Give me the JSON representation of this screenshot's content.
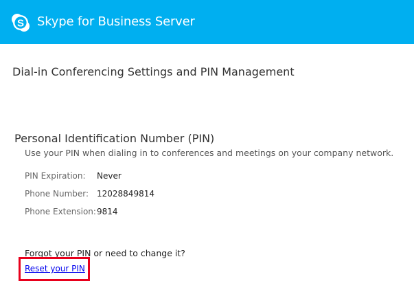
{
  "header": {
    "logo_icon": "skype-logo-icon",
    "title": "Skype for Business Server",
    "background_color": "#00AFF0"
  },
  "page": {
    "title": "Dial-in Conferencing Settings and PIN Management"
  },
  "pin_section": {
    "title": "Personal Identification Number (PIN)",
    "description": "Use your PIN when dialing in to conferences and meetings on your company network.",
    "rows": [
      {
        "label": "PIN Expiration:",
        "value": "Never"
      },
      {
        "label": "Phone Number:",
        "value": "12028849814"
      },
      {
        "label": "Phone Extension:",
        "value": "9814"
      }
    ]
  },
  "reset": {
    "prompt": "Forgot your PIN or need to change it?",
    "link_label": "Reset your PIN",
    "highlight_color": "#E8001C"
  }
}
